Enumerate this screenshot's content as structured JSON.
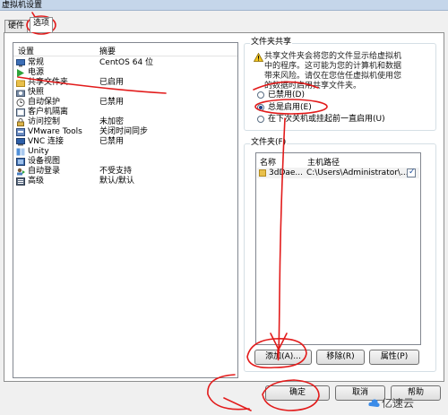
{
  "window": {
    "title": "虚拟机设置"
  },
  "tabs": [
    {
      "label": "硬件"
    },
    {
      "label": "选项"
    }
  ],
  "settings_list": {
    "header": {
      "col1": "设置",
      "col2": "摘要"
    },
    "rows": [
      {
        "name": "常规",
        "summary": "CentOS 64 位",
        "icon": "vm-general-icon"
      },
      {
        "name": "电源",
        "summary": "",
        "icon": "power-play-icon"
      },
      {
        "name": "共享文件夹",
        "summary": "已启用",
        "icon": "shared-folder-icon"
      },
      {
        "name": "快照",
        "summary": "",
        "icon": "snapshot-icon"
      },
      {
        "name": "自动保护",
        "summary": "已禁用",
        "icon": "autoprotect-icon"
      },
      {
        "name": "客户机隔离",
        "summary": "",
        "icon": "guest-isolation-icon"
      },
      {
        "name": "访问控制",
        "summary": "未加密",
        "icon": "access-control-icon"
      },
      {
        "name": "VMware Tools",
        "summary": "关闭时间同步",
        "icon": "vmware-tools-icon"
      },
      {
        "name": "VNC 连接",
        "summary": "已禁用",
        "icon": "vnc-icon"
      },
      {
        "name": "Unity",
        "summary": "",
        "icon": "unity-icon"
      },
      {
        "name": "设备视图",
        "summary": "",
        "icon": "device-view-icon"
      },
      {
        "name": "自动登录",
        "summary": "不受支持",
        "icon": "autologin-icon"
      },
      {
        "name": "高级",
        "summary": "默认/默认",
        "icon": "advanced-icon"
      }
    ]
  },
  "folder_sharing": {
    "title": "文件夹共享",
    "warning": "共享文件夹会将您的文件显示给虚拟机中的程序。这可能为您的计算机和数据带来风险。请仅在您信任虚拟机使用您的数据时启用共享文件夹。",
    "options": [
      {
        "label": "已禁用(D)",
        "selected": false
      },
      {
        "label": "总是启用(E)",
        "selected": true
      },
      {
        "label": "在下次关机或挂起前一直启用(U)",
        "selected": false
      }
    ]
  },
  "folders": {
    "title": "文件夹(F)",
    "header": {
      "name": "名称",
      "path": "主机路径"
    },
    "rows": [
      {
        "name": "3dDae...",
        "path": "C:\\Users\\Administrator\\...",
        "checked": true
      }
    ]
  },
  "folder_buttons": {
    "add": "添加(A)...",
    "remove": "移除(R)",
    "properties": "属性(P)"
  },
  "dialog_buttons": {
    "ok": "确定",
    "cancel": "取消",
    "help": "帮助"
  },
  "watermark": {
    "text": "亿速云"
  }
}
